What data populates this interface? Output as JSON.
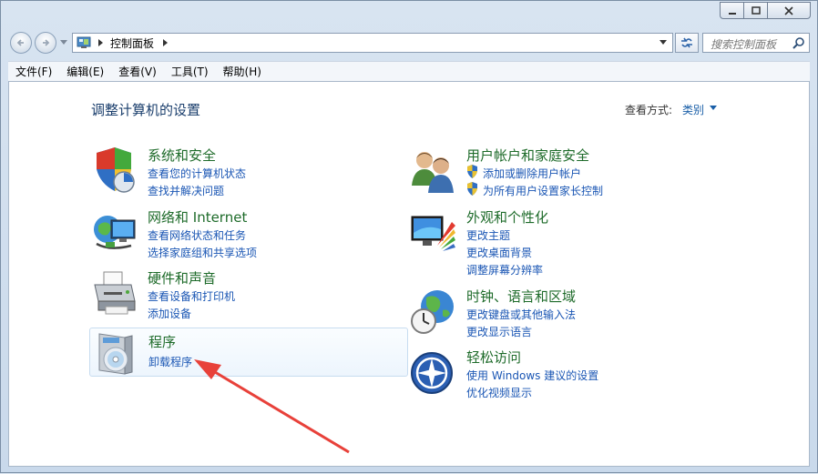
{
  "window": {
    "address": {
      "breadcrumb": "控制面板"
    },
    "search": {
      "placeholder": "搜索控制面板"
    }
  },
  "menu": [
    "文件(F)",
    "编辑(E)",
    "查看(V)",
    "工具(T)",
    "帮助(H)"
  ],
  "page": {
    "title": "调整计算机的设置",
    "view_by_label": "查看方式:",
    "view_by_value": "类别"
  },
  "categories": {
    "system": {
      "title": "系统和安全",
      "links": [
        "查看您的计算机状态",
        "查找并解决问题"
      ]
    },
    "network": {
      "title": "网络和 Internet",
      "links": [
        "查看网络状态和任务",
        "选择家庭组和共享选项"
      ]
    },
    "hardware": {
      "title": "硬件和声音",
      "links": [
        "查看设备和打印机",
        "添加设备"
      ]
    },
    "programs": {
      "title": "程序",
      "links": [
        "卸载程序"
      ]
    },
    "users": {
      "title": "用户帐户和家庭安全",
      "links": [
        "添加或删除用户帐户",
        "为所有用户设置家长控制"
      ]
    },
    "appearance": {
      "title": "外观和个性化",
      "links": [
        "更改主题",
        "更改桌面背景",
        "调整屏幕分辨率"
      ]
    },
    "clock": {
      "title": "时钟、语言和区域",
      "links": [
        "更改键盘或其他输入法",
        "更改显示语言"
      ]
    },
    "ease": {
      "title": "轻松访问",
      "links": [
        "使用 Windows 建议的设置",
        "优化视频显示"
      ]
    }
  },
  "colors": {
    "category_title": "#1e6b2a",
    "link": "#1a56b4",
    "annotation_arrow": "#e8413a"
  }
}
